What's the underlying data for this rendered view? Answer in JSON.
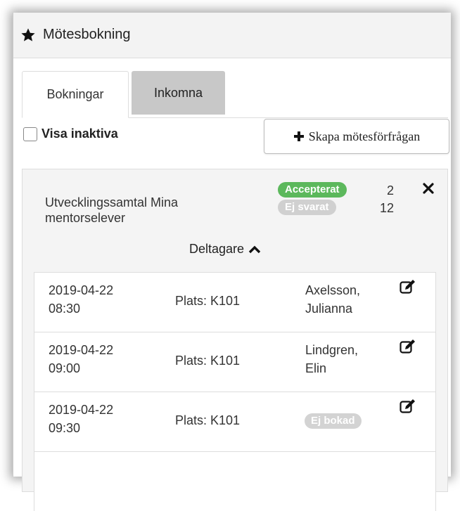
{
  "header": {
    "title": "Mötesbokning",
    "icon": "star-icon"
  },
  "tabs": [
    {
      "label": "Bokningar",
      "active": true
    },
    {
      "label": "Inkomna",
      "active": false
    }
  ],
  "filter": {
    "label": "Visa inaktiva",
    "checked": false
  },
  "create_button": {
    "label": "Skapa mötesförfrågan",
    "icon": "plus-icon"
  },
  "meeting": {
    "title": "Utvecklingssamtal Mina mentorselever",
    "accepted_label": "Accepterat",
    "accepted_count": "2",
    "unanswered_label": "Ej svarat",
    "unanswered_count": "12",
    "participants_toggle": "Deltagare",
    "colors": {
      "accepted": "#5cb85c",
      "unanswered": "#d0d0d0"
    }
  },
  "slots": [
    {
      "date": "2019-04-22",
      "time": "08:30",
      "location": "Plats: K101",
      "name_line1": "Axelsson,",
      "name_line2": "Julianna",
      "status": ""
    },
    {
      "date": "2019-04-22",
      "time": "09:00",
      "location": "Plats: K101",
      "name_line1": "Lindgren,",
      "name_line2": "Elin",
      "status": ""
    },
    {
      "date": "2019-04-22",
      "time": "09:30",
      "location": "Plats: K101",
      "name_line1": "",
      "name_line2": "",
      "status": "Ej bokad"
    }
  ]
}
